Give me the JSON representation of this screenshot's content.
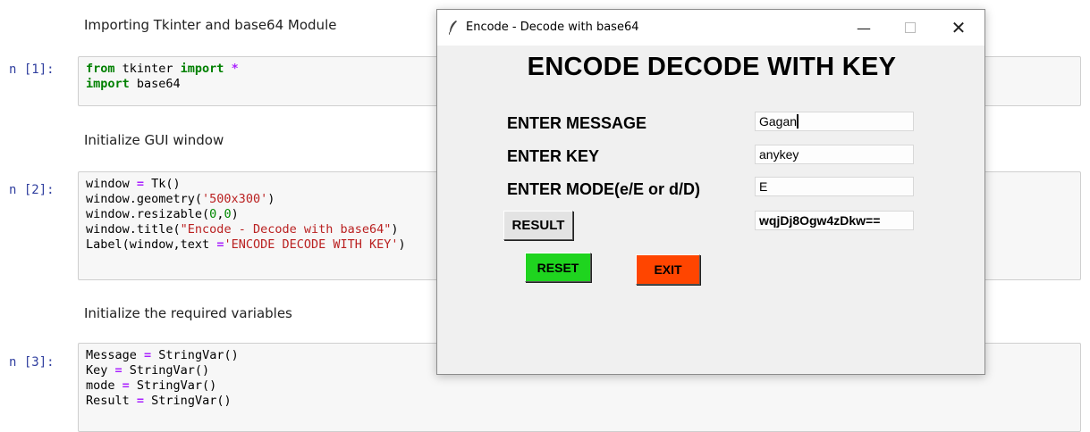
{
  "notebook": {
    "md1": "Importing Tkinter and base64 Module",
    "md2": "Initialize GUI window",
    "md3": "Initialize the required variables",
    "prompt1": "n [1]:",
    "prompt2": "n [2]:",
    "prompt3": "n [3]:"
  },
  "window": {
    "title": "Encode - Decode with base64",
    "minimize_glyph": "—",
    "close_glyph": "✕",
    "heading": "ENCODE DECODE WITH KEY",
    "labels": {
      "message": "ENTER MESSAGE",
      "key": "ENTER KEY",
      "mode": "ENTER MODE(e/E or d/D)"
    },
    "values": {
      "message": "Gagan",
      "key": "anykey",
      "mode": "E",
      "result": "wqjDj8Ogw4zDkw=="
    },
    "buttons": {
      "result": "RESULT",
      "reset": "RESET",
      "exit": "EXIT"
    }
  },
  "colors": {
    "reset_button": "#1fd41f",
    "exit_button": "#ff4500",
    "keyword": "#008000",
    "string": "#ba2121",
    "prompt": "#303f9f"
  }
}
